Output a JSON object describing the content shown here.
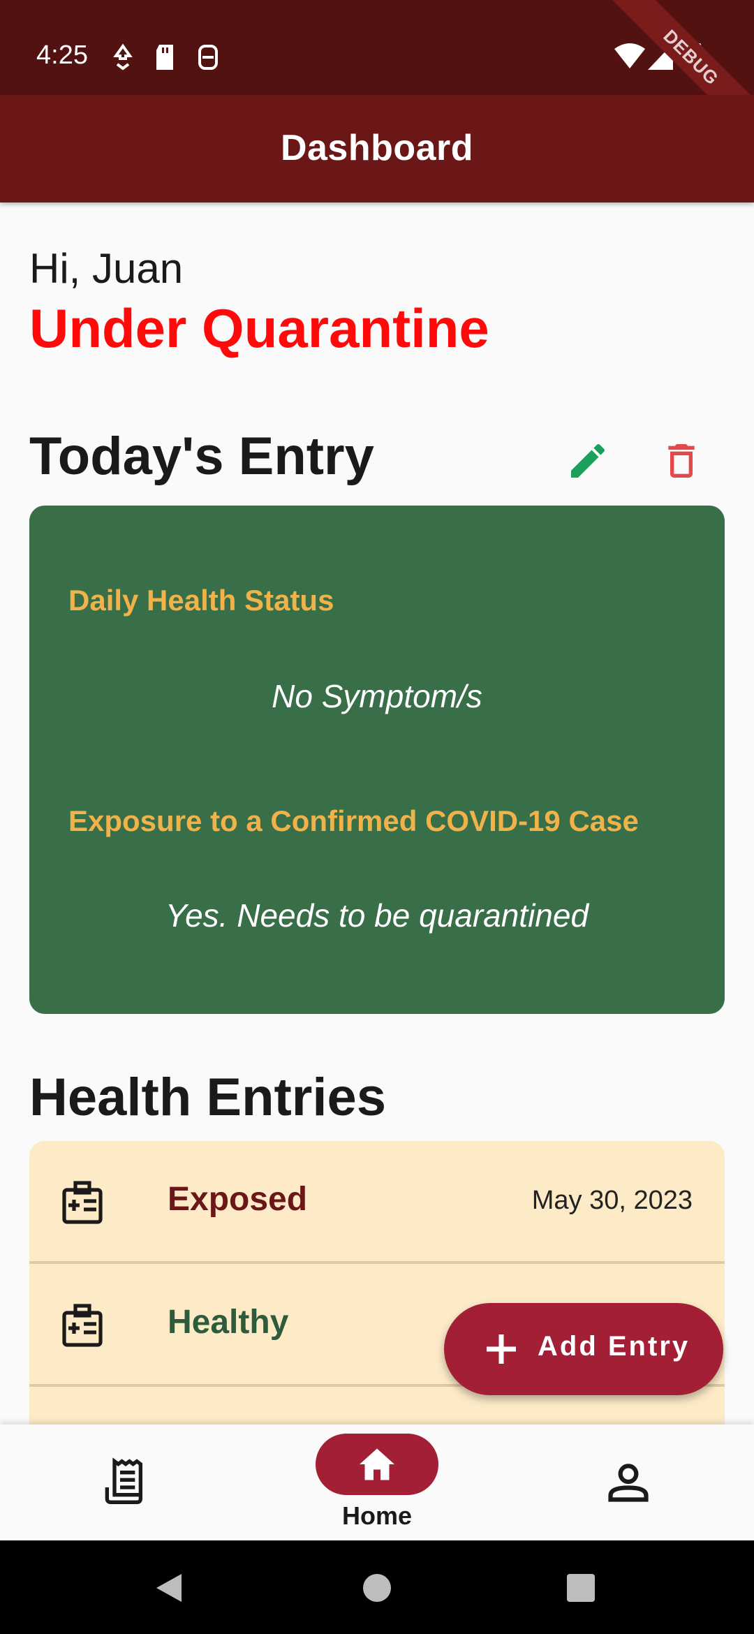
{
  "status_bar": {
    "time": "4:25",
    "left_icons": [
      "download-icon",
      "sd-card-icon",
      "assistant-icon"
    ],
    "right_icons": [
      "wifi-icon",
      "signal-icon",
      "battery-icon"
    ],
    "debug_banner": "DEBUG"
  },
  "app_bar": {
    "title": "Dashboard"
  },
  "greeting": "Hi, Juan",
  "quarantine_status": "Under Quarantine",
  "today": {
    "title": "Today's Entry",
    "edit_icon": "pencil-icon",
    "delete_icon": "trash-icon",
    "health_label": "Daily Health Status",
    "health_value": "No Symptom/s",
    "exposure_label": "Exposure to a Confirmed COVID-19 Case",
    "exposure_value": "Yes. Needs to be quarantined"
  },
  "entries": {
    "title": "Health Entries",
    "rows": [
      {
        "status": "Exposed",
        "date": "May 30, 2023",
        "color": "#6b1717"
      },
      {
        "status": "Healthy",
        "date": "",
        "color": "#2e5b3c"
      }
    ]
  },
  "fab": {
    "label": "Add Entry"
  },
  "bottom_nav": {
    "items": [
      {
        "icon": "receipt-icon",
        "label": ""
      },
      {
        "icon": "home-icon",
        "label": "Home"
      },
      {
        "icon": "person-icon",
        "label": ""
      }
    ],
    "selected": 1
  },
  "colors": {
    "status_bar": "#531212",
    "app_bar": "#6b1717",
    "quarantine": "#ff0a0a",
    "card": "#386e48",
    "card_label": "#f2b24a",
    "entries_bg": "#fdebc8",
    "accent": "#a31f35",
    "edit": "#1aa05a",
    "delete": "#e54848"
  }
}
